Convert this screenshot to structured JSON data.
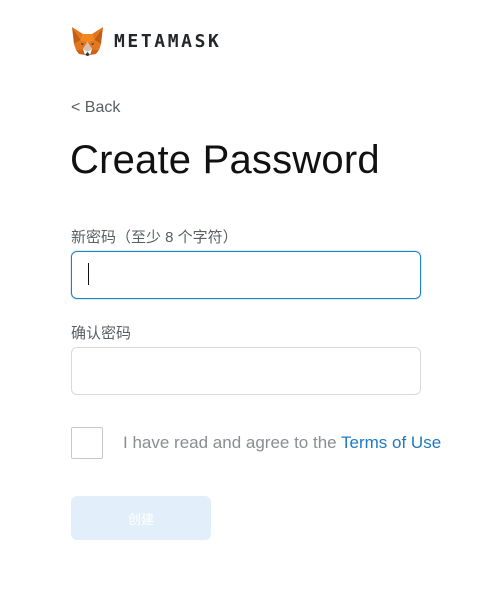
{
  "header": {
    "logo_text": "METAMASK",
    "logo_icon": "fox-icon"
  },
  "nav": {
    "back_label": "< Back"
  },
  "page": {
    "title": "Create Password"
  },
  "form": {
    "new_password_label": "新密码（至少 8 个字符）",
    "new_password_value": "",
    "confirm_password_label": "确认密码",
    "confirm_password_value": "",
    "terms_prefix": "I have read and agree to the ",
    "terms_link": "Terms of Use",
    "terms_checked": false,
    "create_label": "创建",
    "create_enabled": false
  },
  "colors": {
    "accent": "#1f81c4",
    "link": "#1f7ac0",
    "button_disabled_bg": "#e2effa"
  }
}
